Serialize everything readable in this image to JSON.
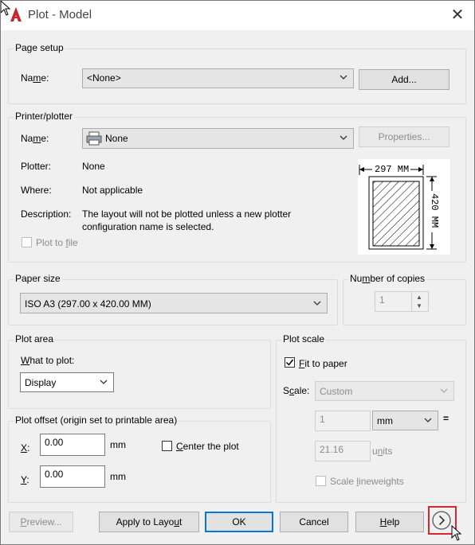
{
  "window": {
    "title": "Plot - Model",
    "close_icon": "close-icon",
    "app_icon": "autocad-logo-icon"
  },
  "page_setup": {
    "legend": "Page setup",
    "name_label": "Name:",
    "name_value": "<None>",
    "add_button": "Add..."
  },
  "printer": {
    "legend": "Printer/plotter",
    "name_label": "Name:",
    "name_value": "None",
    "properties_button": "Properties...",
    "plotter_label": "Plotter:",
    "plotter_value": "None",
    "where_label": "Where:",
    "where_value": "Not applicable",
    "description_label": "Description:",
    "description_line1": "The layout will not be plotted unless a new plotter",
    "description_line2": "configuration name is selected.",
    "plot_to_file": "Plot to file",
    "preview_width": "297  MM",
    "preview_height": "420  MM"
  },
  "paper_size": {
    "legend": "Paper size",
    "value": "ISO A3 (297.00 x 420.00 MM)"
  },
  "copies": {
    "legend": "Number of copies",
    "value": "1"
  },
  "plot_area": {
    "legend": "Plot area",
    "what_label": "What to plot:",
    "what_value": "Display"
  },
  "plot_offset": {
    "legend": "Plot offset (origin set to printable area)",
    "x_label": "X:",
    "x_value": "0.00",
    "x_unit": "mm",
    "y_label": "Y:",
    "y_value": "0.00",
    "y_unit": "mm",
    "center_label": "Center the plot"
  },
  "plot_scale": {
    "legend": "Plot scale",
    "fit_label": "Fit to paper",
    "fit_checked": true,
    "scale_label": "Scale:",
    "scale_value": "Custom",
    "num_value": "1",
    "unit_value": "mm",
    "equals": "=",
    "den_value": "21.16",
    "den_unit": "units",
    "lineweights_label": "Scale lineweights"
  },
  "buttons": {
    "preview": "Preview...",
    "apply": "Apply to Layout",
    "ok": "OK",
    "cancel": "Cancel",
    "help": "Help",
    "more_options_icon": "chevron-right-circle-icon"
  }
}
